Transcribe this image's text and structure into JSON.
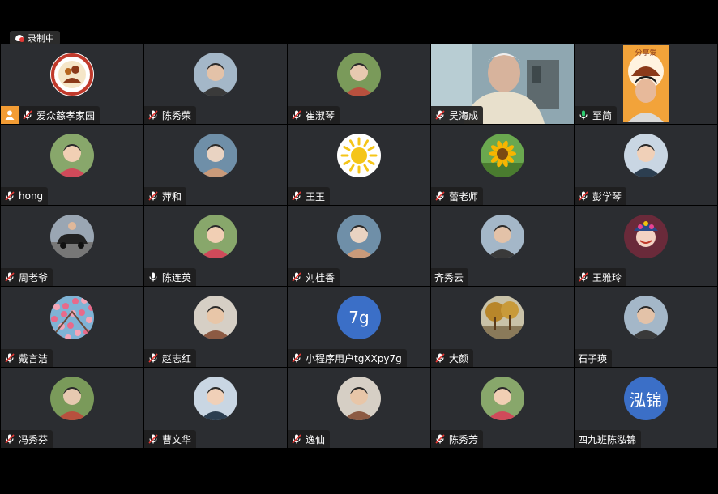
{
  "recording": {
    "label": "录制中"
  },
  "colors": {
    "tile_bg": "#2b2d31",
    "active_border": "#1fbf5c",
    "label_bg": "#1e1e1e",
    "text_avatar_bg": "#3b6fc7"
  },
  "participants": [
    {
      "name": "爱众慈孝家园",
      "mic": "muted",
      "avatar": "logo-avatar",
      "host": true
    },
    {
      "name": "陈秀荣",
      "mic": "muted",
      "avatar": "portrait-avatar"
    },
    {
      "name": "崔淑琴",
      "mic": "muted",
      "avatar": "portrait-avatar"
    },
    {
      "name": "吴海成",
      "mic": "muted",
      "avatar": "camera-video"
    },
    {
      "name": "至简",
      "mic": "active",
      "avatar": "camera-video",
      "speaking": true
    },
    {
      "name": "hong",
      "mic": "muted",
      "avatar": "portrait-avatar"
    },
    {
      "name": "萍和",
      "mic": "muted",
      "avatar": "portrait-avatar"
    },
    {
      "name": "王玉",
      "mic": "muted",
      "avatar": "sun-avatar"
    },
    {
      "name": "蕾老师",
      "mic": "muted",
      "avatar": "sunflower-avatar"
    },
    {
      "name": "彭学琴",
      "mic": "muted",
      "avatar": "portrait-avatar"
    },
    {
      "name": "周老爷",
      "mic": "muted",
      "avatar": "car-avatar"
    },
    {
      "name": "陈连英",
      "mic": "on",
      "avatar": "portrait-avatar"
    },
    {
      "name": "刘桂香",
      "mic": "muted",
      "avatar": "portrait-avatar"
    },
    {
      "name": "齐秀云",
      "mic": "none",
      "avatar": "portrait-avatar"
    },
    {
      "name": "王雅玲",
      "mic": "muted",
      "avatar": "opera-avatar"
    },
    {
      "name": "戴言洁",
      "mic": "muted",
      "avatar": "flowers-avatar"
    },
    {
      "name": "赵志红",
      "mic": "muted",
      "avatar": "portrait-avatar"
    },
    {
      "name": "小程序用户tgXXpy7g",
      "mic": "muted",
      "avatar": "text-avatar",
      "avatar_text": "7g"
    },
    {
      "name": "大颜",
      "mic": "muted",
      "avatar": "autumn-tree-avatar"
    },
    {
      "name": "石子瑛",
      "mic": "none",
      "avatar": "portrait-avatar"
    },
    {
      "name": "冯秀芬",
      "mic": "muted",
      "avatar": "portrait-avatar"
    },
    {
      "name": "曹文华",
      "mic": "muted",
      "avatar": "portrait-avatar"
    },
    {
      "name": "逸仙",
      "mic": "muted",
      "avatar": "portrait-avatar"
    },
    {
      "name": "陈秀芳",
      "mic": "muted",
      "avatar": "portrait-avatar"
    },
    {
      "name": "四九班陈泓锦",
      "mic": "none",
      "avatar": "text-avatar",
      "avatar_text": "泓锦"
    }
  ]
}
